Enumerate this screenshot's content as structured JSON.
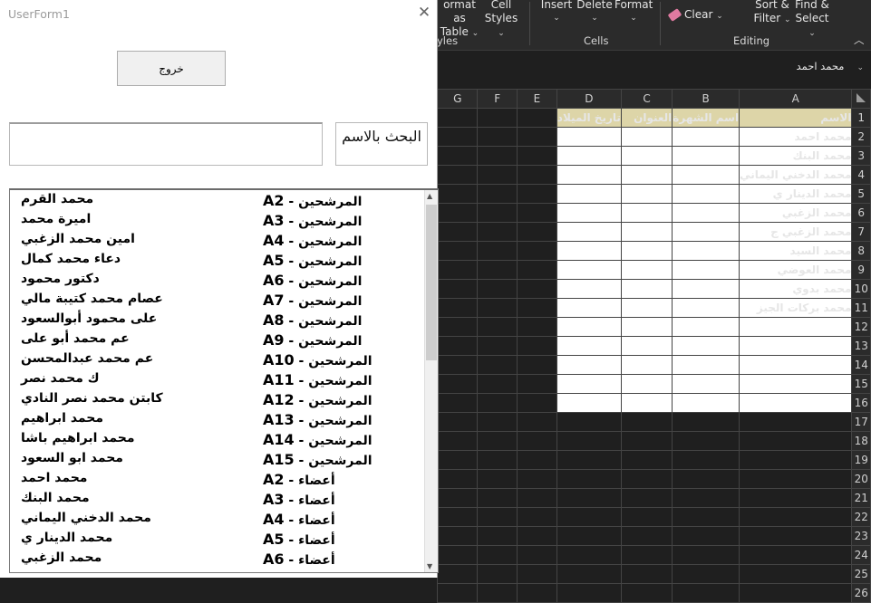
{
  "ribbon": {
    "format_as_table_line1": "ormat as",
    "format_as_table_line2": "Table",
    "cell_styles_line1": "Cell",
    "cell_styles_line2": "Styles",
    "insert": "Insert",
    "delete": "Delete",
    "format": "Format",
    "clear": "Clear",
    "sort_filter_line1": "Sort &",
    "sort_filter_line2": "Filter",
    "find_select_line1": "Find &",
    "find_select_line2": "Select",
    "group_styles": "yles",
    "group_cells": "Cells",
    "group_editing": "Editing",
    "collapse_icon": "chevron-up-icon"
  },
  "namebox": {
    "value": "محمد احمد"
  },
  "sheet": {
    "columns": [
      "A",
      "B",
      "C",
      "D",
      "E",
      "F",
      "G"
    ],
    "headers": [
      "الاسم",
      "اسم الشهرة",
      "العنوان",
      "تاريخ الميلاد"
    ],
    "names": [
      "محمد احمد",
      "محمد البنك",
      "محمد الدخني اليماني",
      "محمد الدينار ي",
      "محمد الزغبي",
      "محمد الزغبي ج",
      "محمد السيد",
      "محمد العوضي",
      "محمد بدوي",
      "محمد بركات الجيز"
    ],
    "row_numbers": [
      "1",
      "2",
      "3",
      "4",
      "5",
      "6",
      "7",
      "8",
      "9",
      "10",
      "11",
      "12",
      "13",
      "14",
      "15",
      "16",
      "17",
      "18",
      "19",
      "20",
      "21",
      "22",
      "23",
      "24",
      "25",
      "26"
    ]
  },
  "userform": {
    "title": "UserForm1",
    "exit_label": "خروج",
    "search_label": "البحث بالاسم",
    "search_value": "",
    "list": [
      {
        "category": "المرشحين - ",
        "ref": "A2",
        "name": "محمد القرم"
      },
      {
        "category": "المرشحين - ",
        "ref": "A3",
        "name": "اميرة محمد"
      },
      {
        "category": "المرشحين - ",
        "ref": "A4",
        "name": "امين محمد الزغبي"
      },
      {
        "category": "المرشحين - ",
        "ref": "A5",
        "name": "دعاء محمد كمال"
      },
      {
        "category": "المرشحين - ",
        "ref": "A6",
        "name": "دكتور محمود"
      },
      {
        "category": "المرشحين - ",
        "ref": "A7",
        "name": "عصام محمد كتيبة مالي"
      },
      {
        "category": "المرشحين - ",
        "ref": "A8",
        "name": "على محمود أبوالسعود"
      },
      {
        "category": "المرشحين - ",
        "ref": "A9",
        "name": "عم محمد أبو على"
      },
      {
        "category": "المرشحين - ",
        "ref": "A10",
        "name": "عم محمد عبدالمحسن"
      },
      {
        "category": "المرشحين - ",
        "ref": "A11",
        "name": "ك محمد نصر"
      },
      {
        "category": "المرشحين - ",
        "ref": "A12",
        "name": "كابتن محمد نصر النادي"
      },
      {
        "category": "المرشحين - ",
        "ref": "A13",
        "name": "محمد ابراهيم"
      },
      {
        "category": "المرشحين - ",
        "ref": "A14",
        "name": "محمد ابراهيم باشا"
      },
      {
        "category": "المرشحين - ",
        "ref": "A15",
        "name": "محمد ابو السعود"
      },
      {
        "category": "أعضاء - ",
        "ref": "A2",
        "name": "محمد احمد"
      },
      {
        "category": "أعضاء - ",
        "ref": "A3",
        "name": "محمد البنك"
      },
      {
        "category": "أعضاء - ",
        "ref": "A4",
        "name": "محمد الدخني اليماني"
      },
      {
        "category": "أعضاء - ",
        "ref": "A5",
        "name": "محمد الدينار ي"
      },
      {
        "category": "أعضاء - ",
        "ref": "A6",
        "name": "محمد الزغبي"
      }
    ]
  }
}
